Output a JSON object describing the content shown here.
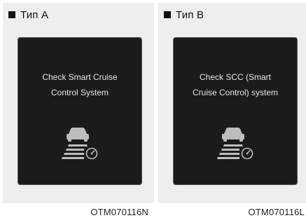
{
  "panels": [
    {
      "type_label": "Тип A",
      "message_line1": "Check Smart Cruise",
      "message_line2": "Control System",
      "image_code": "OTM070116N",
      "icon": "smart-cruise-control-warning-icon"
    },
    {
      "type_label": "Тип B",
      "message_line1": "Check SCC (Smart",
      "message_line2": "Cruise Control) system",
      "image_code": "OTM070116L",
      "icon": "smart-cruise-control-warning-icon"
    }
  ],
  "colors": {
    "panel_background": "#eeeeee",
    "screen_background": "#1b1b1b",
    "screen_text": "#e6e6e6",
    "icon": "#bdbdbd"
  }
}
